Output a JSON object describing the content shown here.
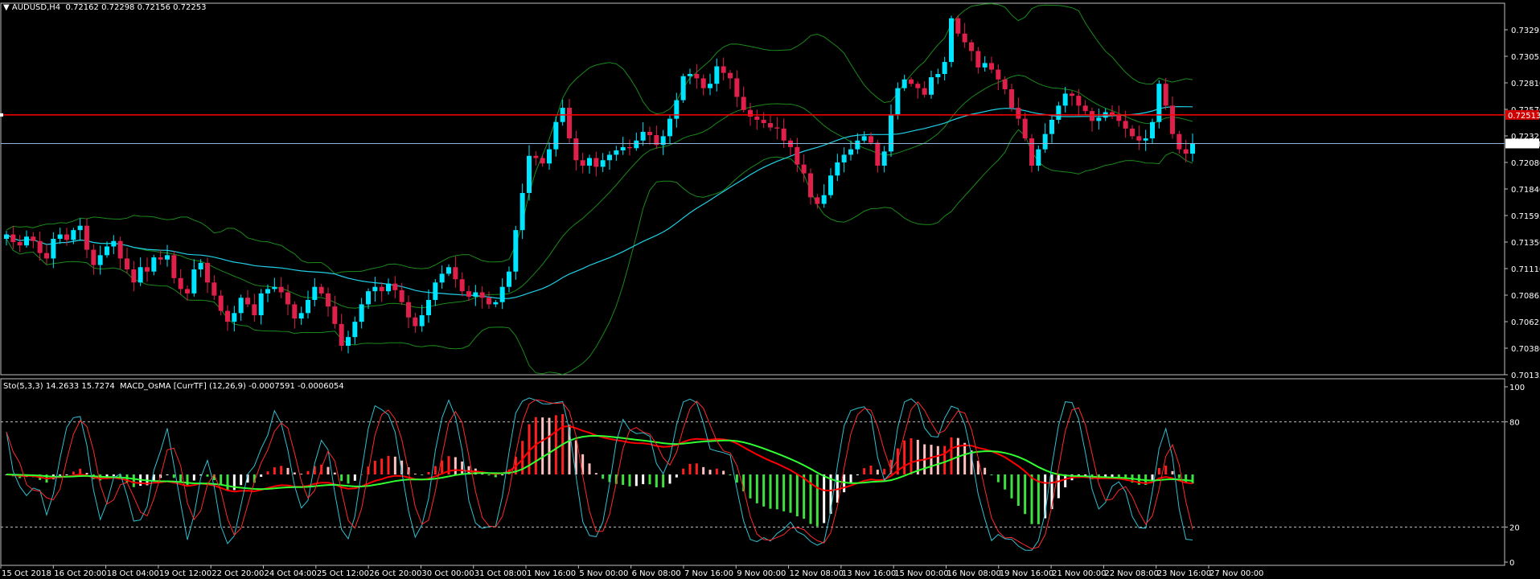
{
  "header": {
    "symbol": "AUDUSD,H4",
    "ohlc": "0.72162 0.72298 0.72156 0.72253"
  },
  "indicator_header": "Sto(5,3,3) 14.2633 15.7274  MACD_OsMA [CurrTF] (12,26,9) -0.0007591 -0.0006054",
  "colors": {
    "bull": "#00e5ff",
    "bear": "#e0204a",
    "bands": "#1a8a1a",
    "ma": "#20d0e8",
    "hline_red": "#ff0000",
    "hline_blue": "#8fb6d8",
    "sto_main": "#30c0d0",
    "sto_signal": "#ff2a2a",
    "macd_pos": "#ff2020",
    "macd_neg": "#40e040",
    "macd_dim_pos": "#ffc0c0",
    "macd_dim_neg": "#ffffff",
    "macd_line": "#ff0000",
    "macd_signal": "#30ff30"
  },
  "chart_data": [
    {
      "type": "candlestick",
      "title": "AUDUSD,H4",
      "ylim": [
        0.70135,
        0.73415
      ],
      "y_ticks": [
        "0.73295",
        "0.73055",
        "0.72810",
        "0.72570",
        "0.72325",
        "0.72080",
        "0.71840",
        "0.71595",
        "0.71350",
        "0.71110",
        "0.70865",
        "0.70625",
        "0.70380",
        "0.70135"
      ],
      "x_labels": [
        "15 Oct 2018",
        "16 Oct 20:00",
        "18 Oct 04:00",
        "19 Oct 12:00",
        "22 Oct 20:00",
        "24 Oct 04:00",
        "25 Oct 12:00",
        "26 Oct 20:00",
        "30 Oct 00:00",
        "31 Oct 08:00",
        "1 Nov 16:00",
        "5 Nov 00:00",
        "6 Nov 08:00",
        "7 Nov 16:00",
        "9 Nov 00:00",
        "12 Nov 08:00",
        "13 Nov 16:00",
        "15 Nov 00:00",
        "16 Nov 08:00",
        "19 Nov 16:00",
        "21 Nov 00:00",
        "22 Nov 08:00",
        "23 Nov 16:00",
        "27 Nov 00:00"
      ],
      "horizontal_lines": [
        {
          "name": "red-level",
          "value": 0.72515,
          "label": "0.72513"
        },
        {
          "name": "bid-line",
          "value": 0.72253,
          "label": "0.72253"
        }
      ],
      "closes": [
        0.7142,
        0.7135,
        0.7132,
        0.714,
        0.7136,
        0.7125,
        0.712,
        0.7138,
        0.7142,
        0.7137,
        0.7146,
        0.715,
        0.7128,
        0.7114,
        0.7123,
        0.7131,
        0.7136,
        0.712,
        0.711,
        0.7098,
        0.7112,
        0.7108,
        0.7121,
        0.7119,
        0.7123,
        0.7102,
        0.7092,
        0.7088,
        0.711,
        0.7116,
        0.7098,
        0.7086,
        0.7072,
        0.7062,
        0.707,
        0.7084,
        0.7078,
        0.7068,
        0.7088,
        0.7092,
        0.7094,
        0.7089,
        0.7078,
        0.7065,
        0.707,
        0.7082,
        0.7094,
        0.7088,
        0.7076,
        0.706,
        0.704,
        0.7048,
        0.7062,
        0.7078,
        0.709,
        0.7094,
        0.709,
        0.7097,
        0.7091,
        0.708,
        0.7066,
        0.7058,
        0.7068,
        0.7082,
        0.7098,
        0.7106,
        0.7112,
        0.7101,
        0.709,
        0.7085,
        0.7089,
        0.7084,
        0.7078,
        0.708,
        0.7094,
        0.7108,
        0.7146,
        0.718,
        0.7214,
        0.7212,
        0.7207,
        0.722,
        0.7245,
        0.7258,
        0.723,
        0.721,
        0.7205,
        0.7212,
        0.7204,
        0.721,
        0.7215,
        0.7219,
        0.7222,
        0.7221,
        0.7228,
        0.7236,
        0.7233,
        0.7224,
        0.7232,
        0.7248,
        0.7265,
        0.7287,
        0.7289,
        0.7285,
        0.7276,
        0.728,
        0.7296,
        0.729,
        0.7285,
        0.7268,
        0.7256,
        0.725,
        0.7247,
        0.7244,
        0.724,
        0.7239,
        0.7228,
        0.7222,
        0.7206,
        0.7198,
        0.7176,
        0.717,
        0.7178,
        0.7196,
        0.7208,
        0.7215,
        0.722,
        0.7228,
        0.7232,
        0.7226,
        0.7205,
        0.7218,
        0.7252,
        0.7276,
        0.7284,
        0.728,
        0.7276,
        0.727,
        0.7286,
        0.7289,
        0.73,
        0.734,
        0.7326,
        0.7318,
        0.731,
        0.7295,
        0.7299,
        0.7293,
        0.7284,
        0.7275,
        0.7258,
        0.7248,
        0.723,
        0.7205,
        0.722,
        0.7234,
        0.7247,
        0.726,
        0.7271,
        0.7269,
        0.726,
        0.7255,
        0.7246,
        0.7249,
        0.7254,
        0.7251,
        0.7246,
        0.7239,
        0.7232,
        0.7228,
        0.723,
        0.7245,
        0.728,
        0.726,
        0.7234,
        0.722,
        0.7216,
        0.7225
      ]
    },
    {
      "type": "indicator",
      "title": "Sto(5,3,3) / MACD_OsMA",
      "ylim": [
        0,
        100
      ],
      "y_ticks": [
        "100",
        "80",
        "20",
        "0"
      ],
      "levels": [
        80,
        20
      ]
    }
  ]
}
